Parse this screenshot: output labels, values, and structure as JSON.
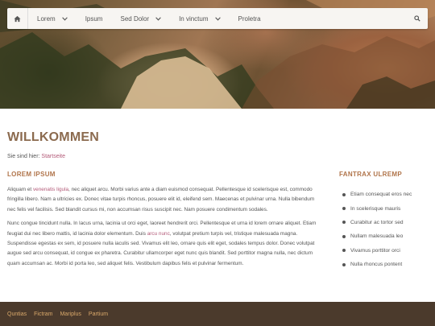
{
  "hero": {
    "image": "canyon-landscape"
  },
  "nav": {
    "home_icon": "home-icon",
    "items": [
      {
        "label": "Lorem",
        "has_dropdown": true
      },
      {
        "label": "Ipsum",
        "has_dropdown": false
      },
      {
        "label": "Sed Dolor",
        "has_dropdown": true
      },
      {
        "label": "In vinctum",
        "has_dropdown": true
      },
      {
        "label": "Proletra",
        "has_dropdown": false
      }
    ],
    "search_icon": "search-icon"
  },
  "page": {
    "title": "WILLKOMMEN",
    "breadcrumb_prefix": "Sie sind hier: ",
    "breadcrumb_link": "Startseite"
  },
  "main": {
    "heading": "LOREM IPSUM",
    "para1": {
      "t1": "Aliquam et ",
      "link1": "venenatis ligula",
      "t2": ", nec aliquet arcu. Morbi varius ante a diam euismod consequat. Pellentesque id scelerisque est, commodo fringilla libero. Nam a ultricies ex. Donec vitae turpis rhoncus, posuere elit id, eleifend sem. Maecenas et pulvinar urna. Nulla bibendum nec felis vel facilisis. Sed blandit cursus mi, non accumsan risus suscipit nec. Nam posuere condimentum sodales."
    },
    "para2": {
      "t1": "Nunc congue tincidunt nulla. In lacus urna, lacinia ut orci eget, laoreet hendrerit orci. Pellentesque et urna id lorem ornare aliquet. Etiam feugiat dui nec libero mattis, id lacinia dolor elementum. Duis ",
      "link1": "arcu nunc",
      "t2": ", volutpat pretium turpis vel, tristique malesuada magna. Suspendisse egestas ex sem, id posuere nulla iaculis sed. Vivamus elit leo, ornare quis elit eget, sodales tempus dolor. Donec volutpat augue sed arcu consequat, id congue ex pharetra. Curabitur ullamcorper eget nunc quis blandit. Sed porttitor magna nulla, nec dictum quam accumsan ac. Morbi id porta leo, sed aliquet felis. Vestibulum dapibus felis et pulvinar fermentum."
    }
  },
  "aside": {
    "heading": "FANTRAX ULREMP",
    "items": [
      "Etiam consequat eros nec",
      "In scelerisque mauris",
      "Curabitur ac tortor sed",
      "Nullam malesuada leo",
      "Vivamus porttitor orci",
      "Nulla rhoncus pontent"
    ]
  },
  "footer": {
    "links": [
      "Quntias",
      "Fictram",
      "Mariplus",
      "Partium"
    ]
  },
  "colors": {
    "accent": "#b0744a",
    "link": "#b35a78",
    "footer_bg": "#4b3a2c",
    "footer_link": "#d9a86a",
    "title": "#8b6a4e"
  }
}
